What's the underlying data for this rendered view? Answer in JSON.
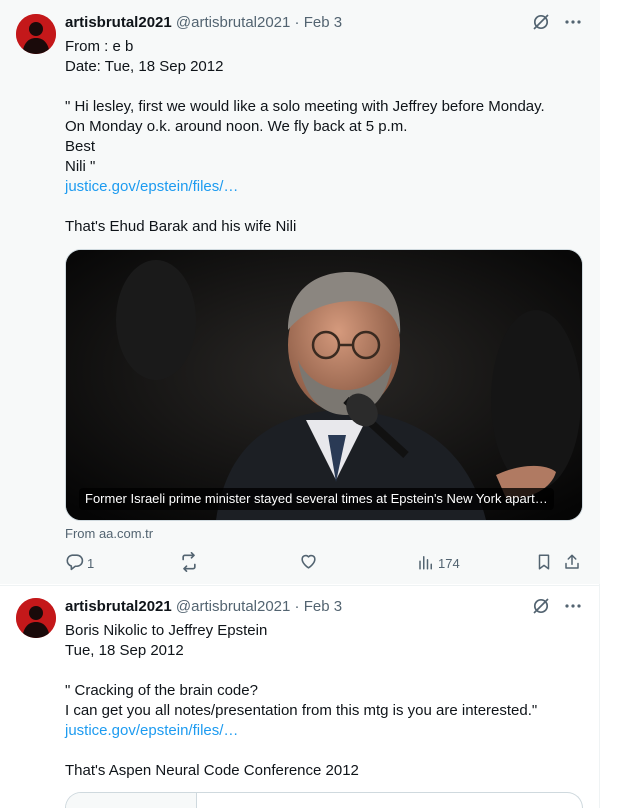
{
  "tweets": [
    {
      "name": "artisbrutal2021",
      "handle": "@artisbrutal2021",
      "separator": "·",
      "date": "Feb 3",
      "lines": [
        "From : e b",
        "Date: Tue, 18 Sep 2012",
        "",
        "\" Hi lesley, first we would like a solo meeting with Jeffrey before Monday.",
        "On Monday o.k. around noon. We fly back at 5 p.m.",
        "Best",
        "Nili \""
      ],
      "link": "justice.gov/epstein/files/…",
      "after_link": "That's Ehud Barak and his wife Nili",
      "media_caption": "Former Israeli prime minister stayed several times at Epstein's New York apart…",
      "source": "From aa.com.tr",
      "replies": "1",
      "views": "174"
    },
    {
      "name": "artisbrutal2021",
      "handle": "@artisbrutal2021",
      "separator": "·",
      "date": "Feb 3",
      "lines": [
        "Boris Nikolic to Jeffrey Epstein",
        "Tue, 18 Sep 2012",
        "",
        "\" Cracking of the brain code?",
        "I can get you all notes/presentation from this mtg is you are interested.\""
      ],
      "link": "justice.gov/epstein/files/…",
      "after_link": "That's Aspen Neural Code Conference 2012"
    }
  ],
  "icons": {
    "grok": "grok-icon",
    "more": "more-icon",
    "reply": "reply-icon",
    "retweet": "retweet-icon",
    "like": "like-icon",
    "views": "views-icon",
    "bookmark": "bookmark-icon",
    "share": "share-icon"
  },
  "colors": {
    "link": "#1d9bf0",
    "secondary_text": "#536471",
    "avatar_red": "#c4181a"
  }
}
